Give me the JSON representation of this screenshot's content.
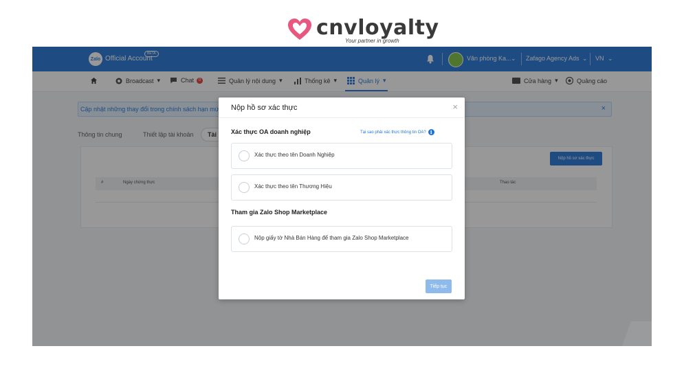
{
  "logo": {
    "name": "cnvloyalty",
    "tagline": "Your partner in growth",
    "icon": "heart-icon"
  },
  "topbar": {
    "title": "Official Account",
    "badge": "BETA",
    "account": "Văn phòng Ka...",
    "agency": "Zafago Agency Ads",
    "language": "VN",
    "caret": "⌄",
    "zalo": "Zalo"
  },
  "nav": {
    "broadcast": "Broadcast",
    "chat": "Chat",
    "chat_badge": "0",
    "content": "Quản lý nội dung",
    "stats": "Thống kê",
    "manage": "Quản lý",
    "store": "Cửa hàng",
    "ads": "Quảng cáo",
    "caret": "▾"
  },
  "notice": {
    "text": "Cập nhật những thay đổi trong chính sách hạn mức g",
    "close": "×"
  },
  "tabs": {
    "general": "Thông tin chung",
    "account_setup": "Thiết lập tài khoản",
    "docs": "Tài li"
  },
  "card": {
    "submit_label": "Nộp hồ sơ xác thực",
    "columns": [
      "#",
      "Ngày chứng thực",
      "Thao tác"
    ]
  },
  "modal": {
    "title": "Nộp hồ sơ xác thực",
    "close": "×",
    "section1": "Xác thực OA doanh nghiệp",
    "help_link": "Tại sao phải xác thực thông tin OA?",
    "info": "i",
    "option1": "Xác thực theo tên Doanh Nghiệp",
    "option2": "Xác thực theo tên Thương Hiệu",
    "section2": "Tham gia Zalo Shop Marketplace",
    "option3": "Nộp giấy tờ Nhà Bán Hàng để tham gia Zalo Shop Marketplace",
    "continue": "Tiếp tục"
  },
  "colors": {
    "brand_blue": "#1e74d6",
    "heart": "#e8577f",
    "overlay": "#1e1e1e"
  }
}
